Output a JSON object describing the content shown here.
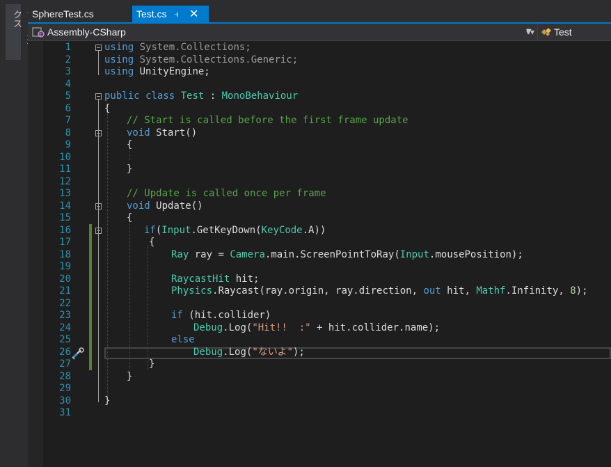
{
  "toolbox": {
    "label": "ツールボックス"
  },
  "tabs": [
    {
      "label": "SphereTest.cs"
    },
    {
      "label": "Test.cs",
      "active": true
    }
  ],
  "tab_pin_icon": "pin-icon",
  "tab_close_icon": "close-icon",
  "navbar": {
    "project": "Assembly-CSharp",
    "class": "Test"
  },
  "editor": {
    "line_numbers": [
      "1",
      "2",
      "3",
      "4",
      "5",
      "6",
      "7",
      "8",
      "9",
      "10",
      "11",
      "12",
      "13",
      "14",
      "15",
      "16",
      "17",
      "18",
      "19",
      "20",
      "21",
      "22",
      "23",
      "24",
      "25",
      "26",
      "27",
      "28",
      "29",
      "30",
      "31"
    ],
    "code": {
      "l1_kw": "using",
      "l1_rest": " System.Collections;",
      "l2_kw": "using",
      "l2_rest": " System.Collections.Generic;",
      "l3_kw": "using",
      "l3_rest": " UnityEngine;",
      "l5_kw1": "public",
      "l5_kw2": "class",
      "l5_name": "Test",
      "l5_colon": " : ",
      "l5_base": "MonoBehaviour",
      "l6": "{",
      "l7": "// Start is called before the first frame update",
      "l8_kw": "void",
      "l8_rest": " Start()",
      "l9": "{",
      "l11": "}",
      "l13": "// Update is called once per frame",
      "l14_kw": "void",
      "l14_rest": " Update()",
      "l15": "{",
      "l16_kw": "if",
      "l16_a": "(",
      "l16_ty": "Input",
      "l16_b": ".GetKeyDown(",
      "l16_ty2": "KeyCode",
      "l16_c": ".A))",
      "l17": "{",
      "l18_ty": "Ray",
      "l18_a": " ray = ",
      "l18_ty2": "Camera",
      "l18_b": ".main.ScreenPointToRay(",
      "l18_ty3": "Input",
      "l18_c": ".mousePosition);",
      "l20_ty": "RaycastHit",
      "l20_a": " hit;",
      "l21_ty": "Physics",
      "l21_a": ".Raycast(ray.origin, ray.direction, ",
      "l21_kw": "out",
      "l21_b": " hit, ",
      "l21_ty2": "Mathf",
      "l21_c": ".Infinity, ",
      "l21_num": "8",
      "l21_d": ");",
      "l23_kw": "if",
      "l23_a": " (hit.collider)",
      "l24_ty": "Debug",
      "l24_a": ".Log(",
      "l24_str": "\"Hit!!  :\"",
      "l24_b": " + hit.collider.name);",
      "l25_kw": "else",
      "l26_ty": "Debug",
      "l26_a": ".Log(",
      "l26_str": "\"ないよ\"",
      "l26_b": ");",
      "l27": "}",
      "l28": "}",
      "l30": "}"
    }
  },
  "colors": {
    "keyword": "#569cd6",
    "type": "#4ec9b0",
    "comment": "#57a64a",
    "string": "#d69d85",
    "number": "#b5cea8",
    "line_number": "#2b91af",
    "change_bar": "#54822f",
    "accent": "#007acc"
  }
}
